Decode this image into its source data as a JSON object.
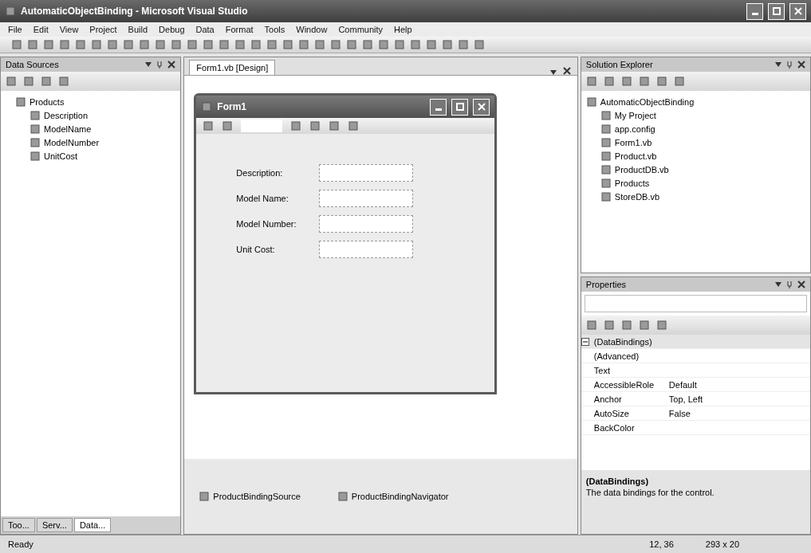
{
  "window": {
    "title": "AutomaticObjectBinding - Microsoft Visual Studio"
  },
  "menu": [
    "File",
    "Edit",
    "View",
    "Project",
    "Build",
    "Debug",
    "Data",
    "Format",
    "Tools",
    "Window",
    "Community",
    "Help"
  ],
  "data_sources": {
    "title": "Data Sources",
    "tree": [
      {
        "label": "Products",
        "children": [
          {
            "label": "Description"
          },
          {
            "label": "ModelName"
          },
          {
            "label": "ModelNumber"
          },
          {
            "label": "UnitCost"
          }
        ]
      }
    ],
    "tabs": [
      {
        "label": "Too...",
        "selected": false
      },
      {
        "label": "Serv...",
        "selected": false
      },
      {
        "label": "Data...",
        "selected": true
      }
    ]
  },
  "document": {
    "tabs": [
      {
        "label": "Form1.vb [Design]",
        "selected": true
      }
    ],
    "form": {
      "title": "Form1",
      "fields": [
        {
          "label": "Description:"
        },
        {
          "label": "Model Name:"
        },
        {
          "label": "Model Number:"
        },
        {
          "label": "Unit Cost:"
        }
      ]
    },
    "tray": [
      {
        "label": "ProductBindingSource"
      },
      {
        "label": "ProductBindingNavigator"
      }
    ]
  },
  "solution_explorer": {
    "title": "Solution Explorer",
    "tree": [
      {
        "label": "AutomaticObjectBinding",
        "children": [
          {
            "label": "My Project"
          },
          {
            "label": "app.config"
          },
          {
            "label": "Form1.vb"
          },
          {
            "label": "Product.vb"
          },
          {
            "label": "ProductDB.vb"
          },
          {
            "label": "Products"
          },
          {
            "label": "StoreDB.vb"
          }
        ]
      }
    ]
  },
  "properties": {
    "title": "Properties",
    "rows": [
      {
        "kind": "category",
        "name": "(DataBindings)",
        "value": ""
      },
      {
        "kind": "property",
        "name": "(Advanced)",
        "value": ""
      },
      {
        "kind": "property",
        "name": "Text",
        "value": ""
      },
      {
        "kind": "property",
        "name": "AccessibleRole",
        "value": "Default"
      },
      {
        "kind": "property",
        "name": "Anchor",
        "value": "Top, Left"
      },
      {
        "kind": "property",
        "name": "AutoSize",
        "value": "False"
      },
      {
        "kind": "property",
        "name": "BackColor",
        "value": ""
      }
    ],
    "description": {
      "title": "(DataBindings)",
      "text": "The data bindings for the control."
    }
  },
  "status_bar": {
    "text": "Ready",
    "position": "12, 36",
    "size": "293 x 20"
  }
}
